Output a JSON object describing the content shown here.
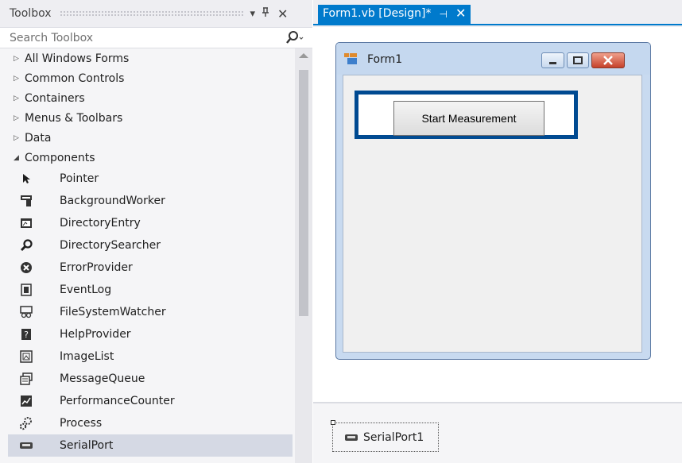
{
  "toolbox": {
    "title": "Toolbox",
    "pin_glyph": "▾",
    "autohide_glyph": "ᵽ",
    "close_glyph": "✕",
    "search_placeholder": "Search Toolbox",
    "categories": [
      {
        "arrow": "▷",
        "label": "All Windows Forms"
      },
      {
        "arrow": "▷",
        "label": "Common Controls"
      },
      {
        "arrow": "▷",
        "label": "Containers"
      },
      {
        "arrow": "▷",
        "label": "Menus & Toolbars"
      },
      {
        "arrow": "▷",
        "label": "Data"
      },
      {
        "arrow": "◢",
        "label": "Components"
      }
    ],
    "items": [
      {
        "label": "Pointer",
        "icon": "pointer-icon"
      },
      {
        "label": "BackgroundWorker",
        "icon": "background-worker-icon"
      },
      {
        "label": "DirectoryEntry",
        "icon": "directory-entry-icon"
      },
      {
        "label": "DirectorySearcher",
        "icon": "directory-searcher-icon"
      },
      {
        "label": "ErrorProvider",
        "icon": "error-provider-icon"
      },
      {
        "label": "EventLog",
        "icon": "event-log-icon"
      },
      {
        "label": "FileSystemWatcher",
        "icon": "file-system-watcher-icon"
      },
      {
        "label": "HelpProvider",
        "icon": "help-provider-icon"
      },
      {
        "label": "ImageList",
        "icon": "image-list-icon"
      },
      {
        "label": "MessageQueue",
        "icon": "message-queue-icon"
      },
      {
        "label": "PerformanceCounter",
        "icon": "performance-counter-icon"
      },
      {
        "label": "Process",
        "icon": "process-icon"
      },
      {
        "label": "SerialPort",
        "icon": "serial-port-icon",
        "selected": true
      }
    ]
  },
  "designer": {
    "tab_label": "Form1.vb [Design]*",
    "tab_pin_glyph": "⊣",
    "tab_close_glyph": "✕",
    "form_title": "Form1",
    "button_label": "Start Measurement",
    "component_label": "SerialPort1"
  },
  "colors": {
    "accent": "#007acc",
    "highlight_border": "#004a91",
    "selected_item": "#d5d9e4"
  }
}
